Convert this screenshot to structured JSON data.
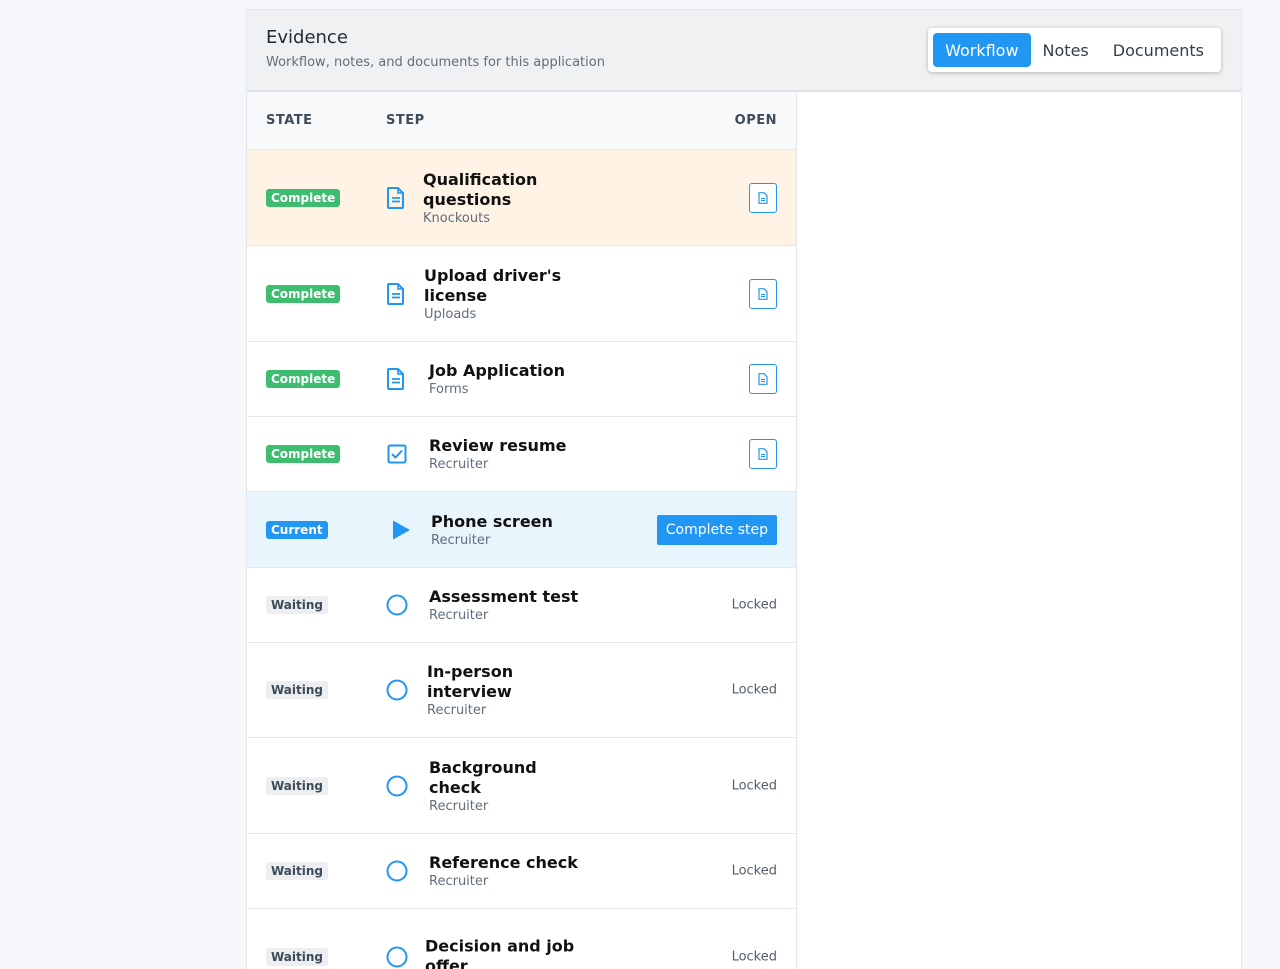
{
  "panel": {
    "title": "Evidence",
    "subtitle": "Workflow, notes, and documents for this application"
  },
  "tabs": [
    {
      "label": "Workflow",
      "active": true
    },
    {
      "label": "Notes",
      "active": false
    },
    {
      "label": "Documents",
      "active": false
    }
  ],
  "table": {
    "headers": {
      "state": "STATE",
      "step": "STEP",
      "open": "OPEN"
    },
    "rows": [
      {
        "state": "Complete",
        "name": "Qualification questions",
        "category": "Knockouts",
        "icon": "document-icon",
        "action": "open"
      },
      {
        "state": "Complete",
        "name": "Upload driver's license",
        "category": "Uploads",
        "icon": "document-icon",
        "action": "open"
      },
      {
        "state": "Complete",
        "name": "Job Application",
        "category": "Forms",
        "icon": "document-icon",
        "action": "open"
      },
      {
        "state": "Complete",
        "name": "Review resume",
        "category": "Recruiter",
        "icon": "checkbox-icon",
        "action": "open"
      },
      {
        "state": "Current",
        "name": "Phone screen",
        "category": "Recruiter",
        "icon": "play-icon",
        "action": "Complete step"
      },
      {
        "state": "Waiting",
        "name": "Assessment test",
        "category": "Recruiter",
        "icon": "circle-icon",
        "action": "Locked"
      },
      {
        "state": "Waiting",
        "name": "In-person interview",
        "category": "Recruiter",
        "icon": "circle-icon",
        "action": "Locked"
      },
      {
        "state": "Waiting",
        "name": "Background check",
        "category": "Recruiter",
        "icon": "circle-icon",
        "action": "Locked"
      },
      {
        "state": "Waiting",
        "name": "Reference check",
        "category": "Recruiter",
        "icon": "circle-icon",
        "action": "Locked"
      },
      {
        "state": "Waiting",
        "name": "Decision and job offer",
        "category": "",
        "icon": "circle-icon",
        "action": "Locked"
      }
    ]
  },
  "colors": {
    "accent": "#2196f3",
    "complete": "#3ebd71",
    "highlight_row": "#fff3e6",
    "current_row": "#e9f5fd"
  }
}
